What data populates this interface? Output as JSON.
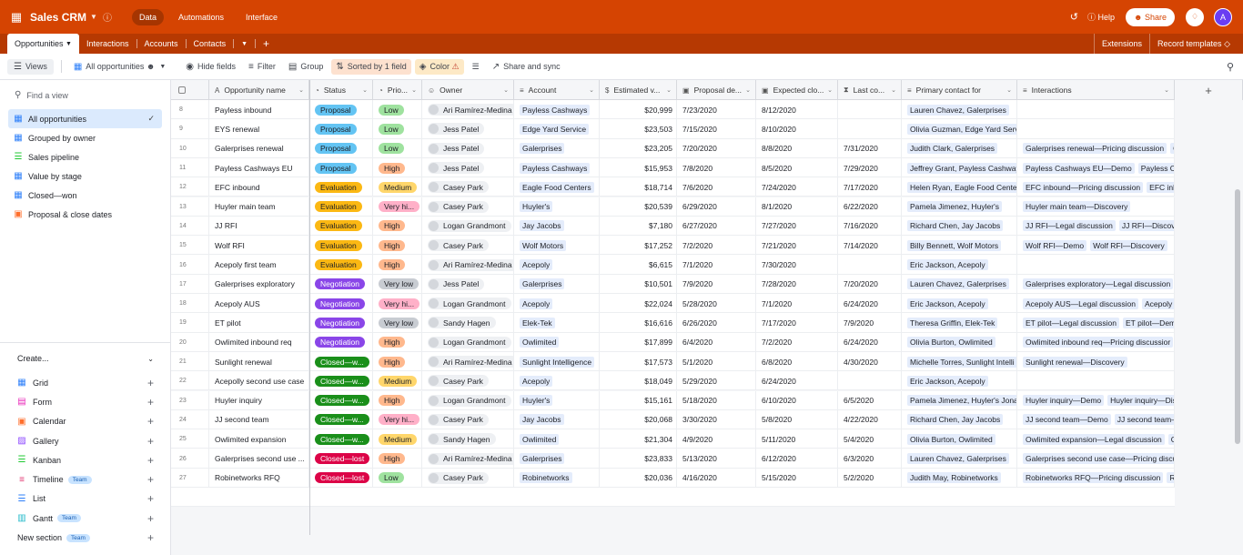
{
  "app": {
    "base_name": "Sales CRM",
    "nav": [
      "Data",
      "Automations",
      "Interface"
    ],
    "nav_active": "Data",
    "help": "Help",
    "share": "Share",
    "avatar_letter": "A",
    "brand_color": "#d54402"
  },
  "tabs": {
    "items": [
      "Opportunities",
      "Interactions",
      "Accounts",
      "Contacts"
    ],
    "extensions": "Extensions",
    "record_templates": "Record templates"
  },
  "toolbar": {
    "views": "Views",
    "current_view": "All opportunities",
    "hide_fields": "Hide fields",
    "filter": "Filter",
    "group": "Group",
    "sorted": "Sorted by 1 field",
    "color": "Color",
    "share_sync": "Share and sync"
  },
  "sidebar": {
    "find_placeholder": "Find a view",
    "views": [
      {
        "label": "All opportunities",
        "icon": "grid-icon",
        "color": "#2d7ff9"
      },
      {
        "label": "Grouped by owner",
        "icon": "grid-icon",
        "color": "#2d7ff9"
      },
      {
        "label": "Sales pipeline",
        "icon": "kanban-icon",
        "color": "#20c933"
      },
      {
        "label": "Value by stage",
        "icon": "grid-icon",
        "color": "#2d7ff9"
      },
      {
        "label": "Closed—won",
        "icon": "grid-icon",
        "color": "#2d7ff9"
      },
      {
        "label": "Proposal & close dates",
        "icon": "calendar-icon",
        "color": "#ff6f2c"
      }
    ],
    "create_label": "Create...",
    "create_items": [
      {
        "label": "Grid",
        "icon": "grid-icon",
        "color": "#2d7ff9",
        "team": ""
      },
      {
        "label": "Form",
        "icon": "form-icon",
        "color": "#e929ba",
        "team": ""
      },
      {
        "label": "Calendar",
        "icon": "calendar-icon",
        "color": "#ff6f2c",
        "team": ""
      },
      {
        "label": "Gallery",
        "icon": "gallery-icon",
        "color": "#8b46ff",
        "team": ""
      },
      {
        "label": "Kanban",
        "icon": "kanban-icon",
        "color": "#20c933",
        "team": ""
      },
      {
        "label": "Timeline",
        "icon": "timeline-icon",
        "color": "#e0336e",
        "team": "Team"
      },
      {
        "label": "List",
        "icon": "list-icon",
        "color": "#2d7ff9",
        "team": ""
      },
      {
        "label": "Gantt",
        "icon": "gantt-icon",
        "color": "#20b9c9",
        "team": "Team"
      },
      {
        "label": "New section",
        "icon": "",
        "color": "",
        "team": "Team"
      }
    ]
  },
  "grid": {
    "headers": [
      "Opportunity name",
      "Status",
      "Prio...",
      "Owner",
      "Account",
      "Estimated v...",
      "Proposal de...",
      "Expected clo...",
      "Last co...",
      "Primary contact for",
      "Interactions"
    ],
    "rows": [
      {
        "n": "8",
        "name": "Payless inbound",
        "status": "Proposal",
        "prio": "Low",
        "owner": "Ari Ramírez-Medina",
        "account": "Payless Cashways",
        "value": "$20,999",
        "proposal": "7/23/2020",
        "close": "8/12/2020",
        "last": "",
        "contact": "Lauren Chavez, Galerprises",
        "inter": []
      },
      {
        "n": "9",
        "name": "EYS renewal",
        "status": "Proposal",
        "prio": "Low",
        "owner": "Jess Patel",
        "account": "Edge Yard Service",
        "value": "$23,503",
        "proposal": "7/15/2020",
        "close": "8/10/2020",
        "last": "",
        "contact": "Olivia Guzman, Edge Yard Servi",
        "inter": []
      },
      {
        "n": "10",
        "name": "Galerprises renewal",
        "status": "Proposal",
        "prio": "Low",
        "owner": "Jess Patel",
        "account": "Galerprises",
        "value": "$23,205",
        "proposal": "7/20/2020",
        "close": "8/8/2020",
        "last": "7/31/2020",
        "contact": "Judith Clark, Galerprises",
        "inter": [
          "Galerprises renewal—Pricing discussion",
          "Ga"
        ]
      },
      {
        "n": "11",
        "name": "Payless Cashways EU",
        "status": "Proposal",
        "prio": "High",
        "owner": "Jess Patel",
        "account": "Payless Cashways",
        "value": "$15,953",
        "proposal": "7/8/2020",
        "close": "8/5/2020",
        "last": "7/29/2020",
        "contact": "Jeffrey Grant, Payless Cashways",
        "inter": [
          "Payless Cashways EU—Demo",
          "Payless Cash"
        ]
      },
      {
        "n": "12",
        "name": "EFC inbound",
        "status": "Evaluation",
        "prio": "Medium",
        "owner": "Casey Park",
        "account": "Eagle Food Centers",
        "value": "$18,714",
        "proposal": "7/6/2020",
        "close": "7/24/2020",
        "last": "7/17/2020",
        "contact": "Helen Ryan, Eagle Food Center",
        "inter": [
          "EFC inbound—Pricing discussion",
          "EFC inbo"
        ]
      },
      {
        "n": "13",
        "name": "Huyler main team",
        "status": "Evaluation",
        "prio": "Very hi...",
        "owner": "Casey Park",
        "account": "Huyler's",
        "value": "$20,539",
        "proposal": "6/29/2020",
        "close": "8/1/2020",
        "last": "6/22/2020",
        "contact": "Pamela Jimenez, Huyler's",
        "inter": [
          "Huyler main team—Discovery"
        ]
      },
      {
        "n": "14",
        "name": "JJ RFI",
        "status": "Evaluation",
        "prio": "High",
        "owner": "Logan Grandmont",
        "account": "Jay Jacobs",
        "value": "$7,180",
        "proposal": "6/27/2020",
        "close": "7/27/2020",
        "last": "7/16/2020",
        "contact": "Richard Chen, Jay Jacobs",
        "inter": [
          "JJ RFI—Legal discussion",
          "JJ RFI—Discovery"
        ]
      },
      {
        "n": "15",
        "name": "Wolf RFI",
        "status": "Evaluation",
        "prio": "High",
        "owner": "Casey Park",
        "account": "Wolf Motors",
        "value": "$17,252",
        "proposal": "7/2/2020",
        "close": "7/21/2020",
        "last": "7/14/2020",
        "contact": "Billy Bennett, Wolf Motors",
        "inter": [
          "Wolf RFI—Demo",
          "Wolf RFI—Discovery"
        ]
      },
      {
        "n": "16",
        "name": "Acepoly first team",
        "status": "Evaluation",
        "prio": "High",
        "owner": "Ari Ramírez-Medina",
        "account": "Acepoly",
        "value": "$6,615",
        "proposal": "7/1/2020",
        "close": "7/30/2020",
        "last": "",
        "contact": "Eric Jackson, Acepoly",
        "inter": []
      },
      {
        "n": "17",
        "name": "Galerprises exploratory",
        "status": "Negotiation",
        "prio": "Very low",
        "owner": "Jess Patel",
        "account": "Galerprises",
        "value": "$10,501",
        "proposal": "7/9/2020",
        "close": "7/28/2020",
        "last": "7/20/2020",
        "contact": "Lauren Chavez, Galerprises",
        "inter": [
          "Galerprises exploratory—Legal discussion",
          "G"
        ]
      },
      {
        "n": "18",
        "name": "Acepoly AUS",
        "status": "Negotiation",
        "prio": "Very hi...",
        "owner": "Logan Grandmont",
        "account": "Acepoly",
        "value": "$22,024",
        "proposal": "5/28/2020",
        "close": "7/1/2020",
        "last": "6/24/2020",
        "contact": "Eric Jackson, Acepoly",
        "inter": [
          "Acepoly AUS—Legal discussion",
          "Acepoly AU"
        ]
      },
      {
        "n": "19",
        "name": "ET pilot",
        "status": "Negotiation",
        "prio": "Very low",
        "owner": "Sandy Hagen",
        "account": "Elek-Tek",
        "value": "$16,616",
        "proposal": "6/26/2020",
        "close": "7/17/2020",
        "last": "7/9/2020",
        "contact": "Theresa Griffin, Elek-Tek",
        "inter": [
          "ET pilot—Legal discussion",
          "ET pilot—Demo"
        ]
      },
      {
        "n": "20",
        "name": "Owlimited inbound req",
        "status": "Negotiation",
        "prio": "High",
        "owner": "Logan Grandmont",
        "account": "Owlimited",
        "value": "$17,899",
        "proposal": "6/4/2020",
        "close": "7/2/2020",
        "last": "6/24/2020",
        "contact": "Olivia Burton, Owlimited",
        "inter": [
          "Owlimited inbound req—Pricing discussior"
        ]
      },
      {
        "n": "21",
        "name": "Sunlight renewal",
        "status": "Closed—w...",
        "prio": "High",
        "owner": "Ari Ramírez-Medina",
        "account": "Sunlight Intelligence",
        "value": "$17,573",
        "proposal": "5/1/2020",
        "close": "6/8/2020",
        "last": "4/30/2020",
        "contact": "Michelle Torres, Sunlight Intelli",
        "inter": [
          "Sunlight renewal—Discovery"
        ]
      },
      {
        "n": "22",
        "name": "Acepolly second use case",
        "status": "Closed—w...",
        "prio": "Medium",
        "owner": "Casey Park",
        "account": "Acepoly",
        "value": "$18,049",
        "proposal": "5/29/2020",
        "close": "6/24/2020",
        "last": "",
        "contact": "Eric Jackson, Acepoly",
        "inter": []
      },
      {
        "n": "23",
        "name": "Huyler inquiry",
        "status": "Closed—w...",
        "prio": "High",
        "owner": "Logan Grandmont",
        "account": "Huyler's",
        "value": "$15,161",
        "proposal": "5/18/2020",
        "close": "6/10/2020",
        "last": "6/5/2020",
        "contact": "Pamela Jimenez, Huyler's  Jona",
        "inter": [
          "Huyler inquiry—Demo",
          "Huyler inquiry—Dis"
        ]
      },
      {
        "n": "24",
        "name": "JJ second team",
        "status": "Closed—w...",
        "prio": "Very hi...",
        "owner": "Casey Park",
        "account": "Jay Jacobs",
        "value": "$20,068",
        "proposal": "3/30/2020",
        "close": "5/8/2020",
        "last": "4/22/2020",
        "contact": "Richard Chen, Jay Jacobs",
        "inter": [
          "JJ second team—Demo",
          "JJ second team—D"
        ]
      },
      {
        "n": "25",
        "name": "Owlimited expansion",
        "status": "Closed—w...",
        "prio": "Medium",
        "owner": "Sandy Hagen",
        "account": "Owlimited",
        "value": "$21,304",
        "proposal": "4/9/2020",
        "close": "5/11/2020",
        "last": "5/4/2020",
        "contact": "Olivia Burton, Owlimited",
        "inter": [
          "Owlimited expansion—Legal discussion",
          "Ow"
        ]
      },
      {
        "n": "26",
        "name": "Galerprises second use ...",
        "status": "Closed—lost",
        "prio": "High",
        "owner": "Ari Ramírez-Medina",
        "account": "Galerprises",
        "value": "$23,833",
        "proposal": "5/13/2020",
        "close": "6/12/2020",
        "last": "6/3/2020",
        "contact": "Lauren Chavez, Galerprises",
        "inter": [
          "Galerprises second use case—Pricing discu"
        ]
      },
      {
        "n": "27",
        "name": "Robinetworks RFQ",
        "status": "Closed—lost",
        "prio": "Low",
        "owner": "Casey Park",
        "account": "Robinetworks",
        "value": "$20,036",
        "proposal": "4/16/2020",
        "close": "5/15/2020",
        "last": "5/2/2020",
        "contact": "Judith May, Robinetworks",
        "inter": [
          "Robinetworks RFQ—Pricing discussion",
          "Rob"
        ]
      }
    ]
  }
}
